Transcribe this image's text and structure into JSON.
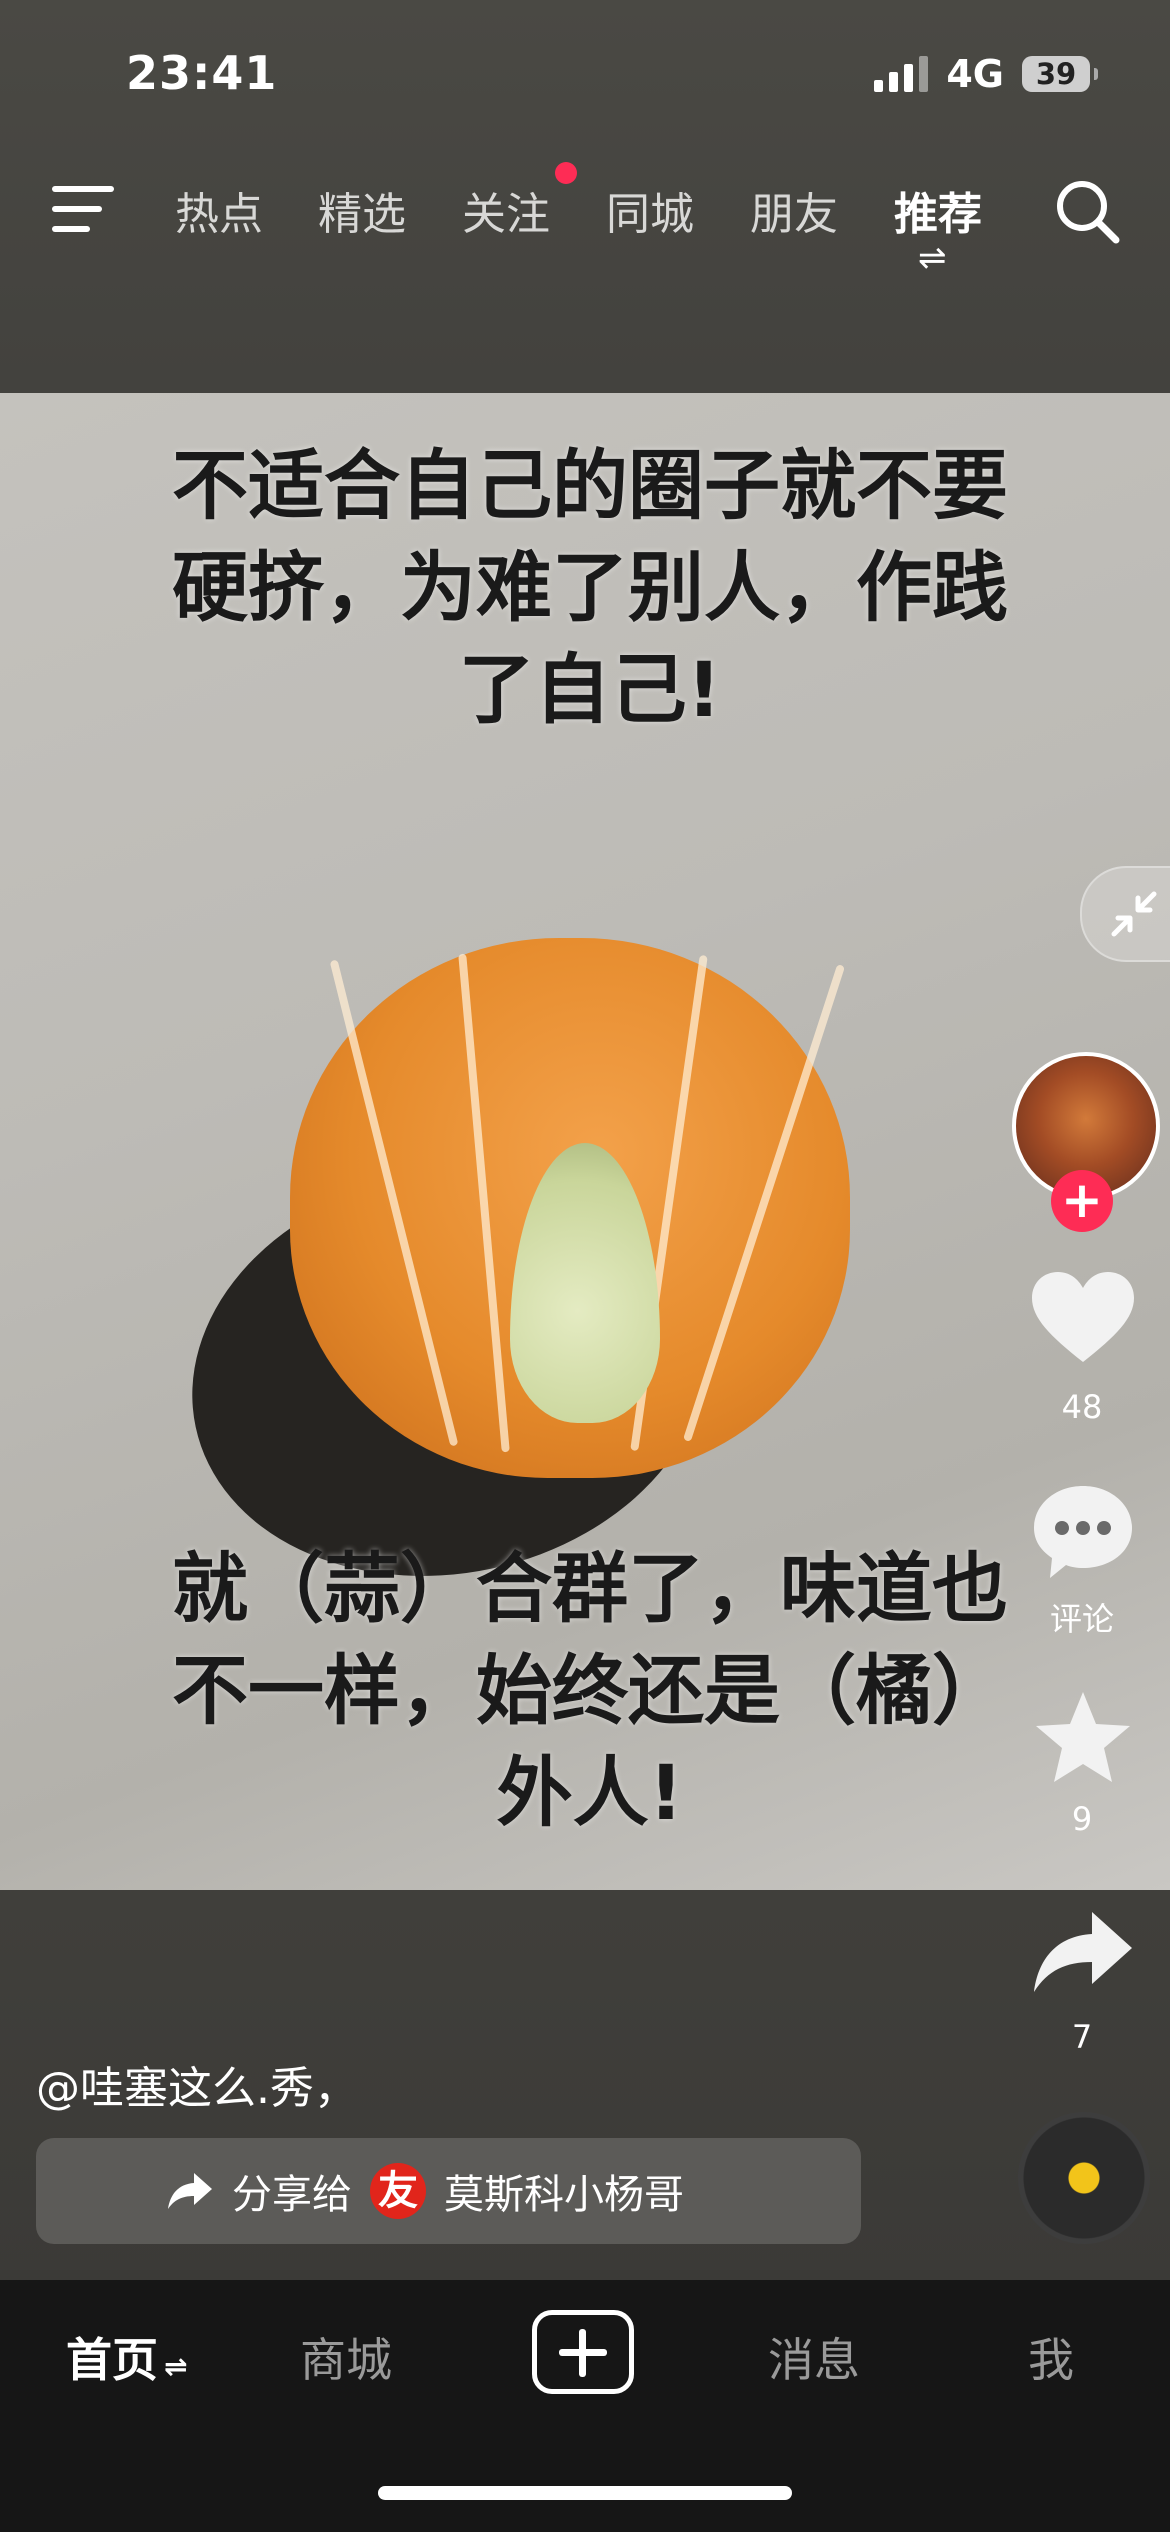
{
  "status_bar": {
    "time": "23:41",
    "network": "4G",
    "battery": "39"
  },
  "top_nav": {
    "tabs": [
      "热点",
      "精选",
      "关注",
      "同城",
      "朋友",
      "推荐"
    ],
    "active_tab": "推荐"
  },
  "post": {
    "caption_top": [
      "不适合自己的圈子就不要",
      "硬挤，为难了别人，作践",
      "了自己!"
    ],
    "caption_bottom": [
      "就（蒜）合群了，味道也",
      "不一样，始终还是（橘）",
      "外人!"
    ],
    "author": "@哇塞这么.秀，",
    "share_text": "分享给",
    "share_friend_badge": "友",
    "share_friend": "莫斯科小杨哥"
  },
  "right_rail": {
    "likes": "48",
    "comments_label": "评论",
    "favorites": "9",
    "shares": "7"
  },
  "bottom_tabs": {
    "home": "首页",
    "mall": "商城",
    "messages": "消息",
    "me": "我"
  },
  "colors": {
    "accent": "#fe2c55",
    "tabbar_bg": "#161616",
    "friend_badge": "#e1251b",
    "music_dot": "#f2c41a"
  }
}
